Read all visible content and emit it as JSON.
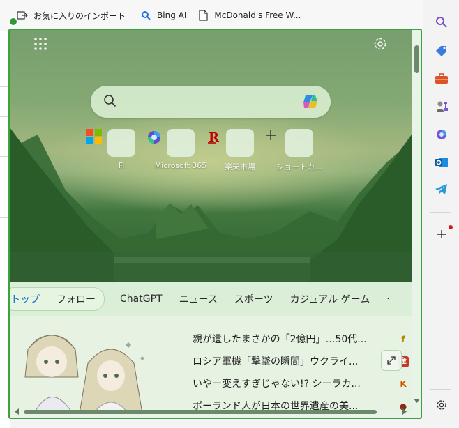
{
  "favorites": [
    {
      "label": "お気に入りのインポート",
      "icon": "import-favorites-icon"
    },
    {
      "label": "Bing AI",
      "icon": "bing-search-icon"
    },
    {
      "label": "McDonald's Free W...",
      "icon": "page-icon"
    }
  ],
  "newtab": {
    "search_placeholder": "",
    "tiles": [
      {
        "label": "Fi",
        "icon": "microsoft-logo-icon"
      },
      {
        "label": "Microsoft 365",
        "icon": "microsoft-365-icon"
      },
      {
        "label": "楽天市場",
        "icon": "rakuten-icon"
      },
      {
        "label": "ショートカ...",
        "icon": "add-shortcut-icon"
      }
    ],
    "feed_tabs": [
      {
        "label": "トップ",
        "active": true
      },
      {
        "label": "フォロー"
      },
      {
        "label": "ChatGPT"
      },
      {
        "label": "ニュース"
      },
      {
        "label": "スポーツ"
      },
      {
        "label": "カジュアル ゲーム"
      }
    ],
    "headlines": [
      {
        "text": "親が遺したまさかの「2億円」…50代...",
        "source_icon": "f",
        "source_color": "#b08a00"
      },
      {
        "text": "ロシア軍機「撃墜の瞬間」ウクライ...",
        "source_icon": "産",
        "source_color": "#c0392b"
      },
      {
        "text": "いやー変えすぎじゃない!? シーラカ...",
        "source_icon": "K",
        "source_color": "#d35400"
      },
      {
        "text": "ポーランド人が日本の世界遺産の美...",
        "source_icon": "●",
        "source_color": "#8e2a15"
      }
    ]
  },
  "sidebar": [
    {
      "name": "search-icon"
    },
    {
      "name": "shopping-tag-icon"
    },
    {
      "name": "tools-briefcase-icon"
    },
    {
      "name": "games-chess-icon"
    },
    {
      "name": "microsoft-365-icon"
    },
    {
      "name": "outlook-icon"
    },
    {
      "name": "telegram-icon"
    },
    {
      "name": "add-icon"
    },
    {
      "name": "settings-icon"
    }
  ]
}
